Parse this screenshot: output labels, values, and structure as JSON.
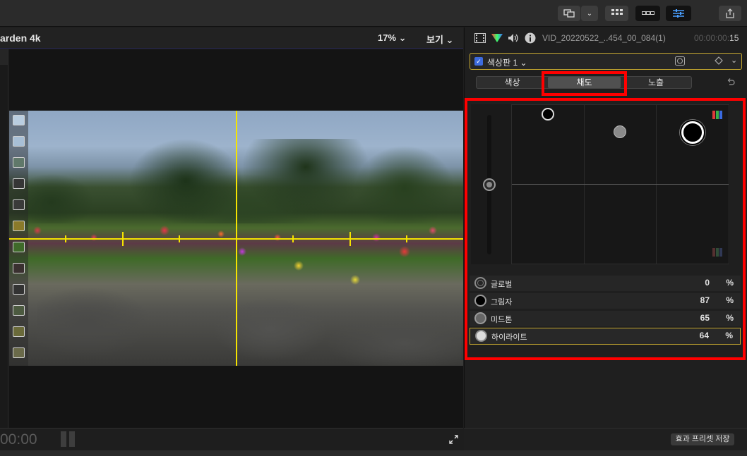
{
  "viewer": {
    "title": "arden 4k",
    "zoom": "17% ⌄",
    "view_menu": "보기 ⌄",
    "timecode": "00:00"
  },
  "inspector": {
    "clip_name": "VID_20220522_..454_00_084(1)",
    "clip_time_dim": "00:00:00:",
    "clip_time_frames": "15",
    "board_label": "색상판 1 ⌄",
    "tabs": [
      "색상",
      "채도",
      "노출"
    ],
    "active_tab": "채도",
    "params": [
      {
        "label": "글로벌",
        "value": "0",
        "unit": "%"
      },
      {
        "label": "그림자",
        "value": "87",
        "unit": "%"
      },
      {
        "label": "미드톤",
        "value": "65",
        "unit": "%"
      },
      {
        "label": "하이라이트",
        "value": "64",
        "unit": "%"
      }
    ],
    "save_preset": "효과 프리셋 저장"
  },
  "colors": {
    "guide_yellow": "#f5e400",
    "highlight_red": "#ff0000",
    "selection_gold": "#c7a930",
    "checkbox_blue": "#3d6bde"
  }
}
